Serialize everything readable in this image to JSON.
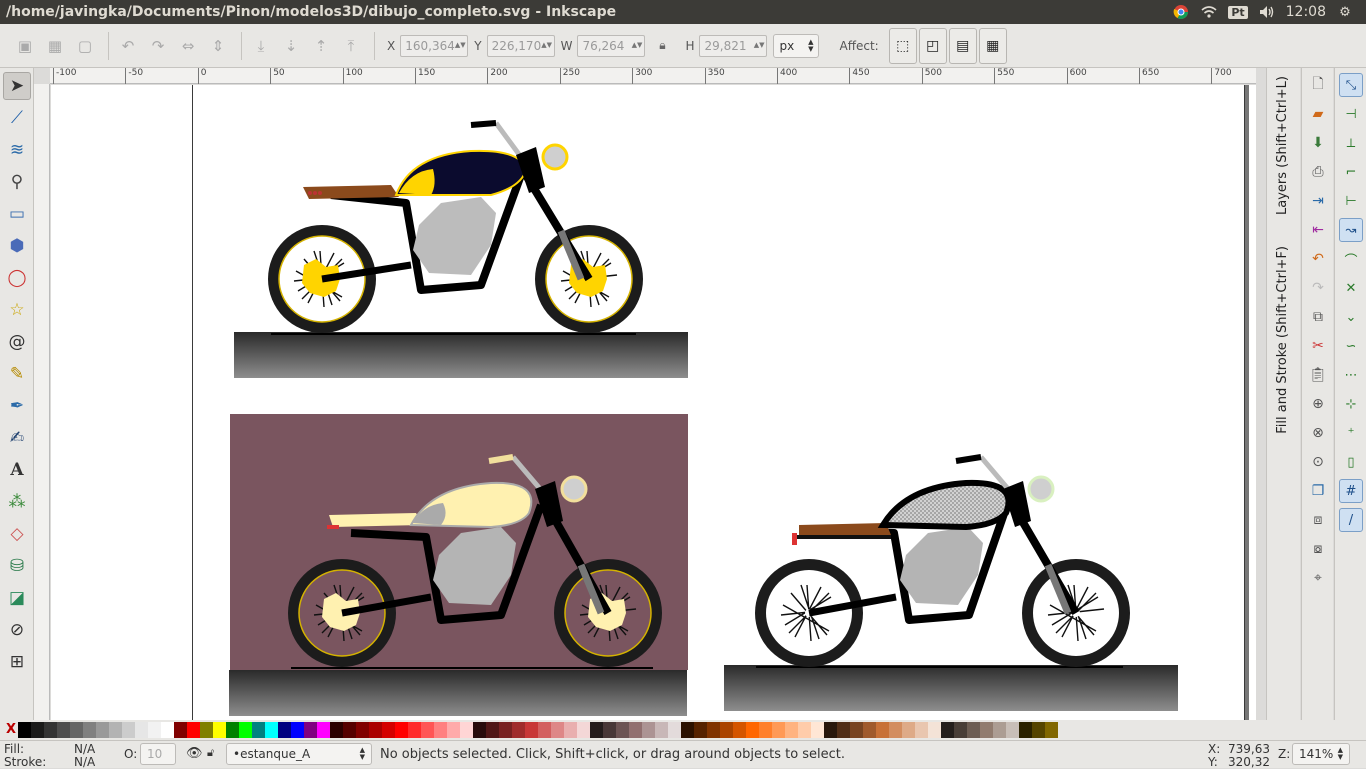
{
  "titlebar": {
    "title": "/home/javingka/Documents/Pinon/modelos3D/dibujo_completo.svg - Inkscape",
    "lang": "Pt",
    "clock": "12:08"
  },
  "controls": {
    "x_label": "X",
    "x_value": "160,364",
    "y_label": "Y",
    "y_value": "226,170",
    "w_label": "W",
    "w_value": "76,264",
    "h_label": "H",
    "h_value": "29,821",
    "unit": "px",
    "affect_label": "Affect:"
  },
  "ruler": {
    "ticks": [
      "-100",
      "-50",
      "0",
      "50",
      "100",
      "150",
      "200",
      "250",
      "300",
      "350",
      "400",
      "450",
      "500",
      "550",
      "600",
      "650",
      "700"
    ]
  },
  "docks": {
    "layers_tab": "Layers (Shift+Ctrl+L)",
    "fill_stroke_tab": "Fill and Stroke (Shift+Ctrl+F)"
  },
  "palette": {
    "none_label": "X",
    "colors": [
      "#000000",
      "#1a1a1a",
      "#333333",
      "#4d4d4d",
      "#666666",
      "#808080",
      "#999999",
      "#b3b3b3",
      "#cccccc",
      "#e6e6e6",
      "#f2f2f2",
      "#ffffff",
      "#800000",
      "#ff0000",
      "#808000",
      "#ffff00",
      "#008000",
      "#00ff00",
      "#008080",
      "#00ffff",
      "#000080",
      "#0000ff",
      "#800080",
      "#ff00ff",
      "#2b0000",
      "#550000",
      "#800000",
      "#aa0000",
      "#d40000",
      "#ff0000",
      "#ff2a2a",
      "#ff5555",
      "#ff8080",
      "#ffaaaa",
      "#ffd5d5",
      "#280b0b",
      "#501616",
      "#782121",
      "#a02c2c",
      "#c83737",
      "#d35f5f",
      "#de8787",
      "#e9afaf",
      "#f4d7d7",
      "#241c1c",
      "#483737",
      "#6c5353",
      "#916f6f",
      "#ac9393",
      "#c8b7b7",
      "#e3dbdb",
      "#2b1100",
      "#552200",
      "#803300",
      "#aa4400",
      "#d45500",
      "#ff6600",
      "#ff7f2a",
      "#ff9955",
      "#ffb380",
      "#ffccaa",
      "#ffe6d5",
      "#28170b",
      "#502d16",
      "#784421",
      "#a05a2c",
      "#c87137",
      "#d38d5f",
      "#deaa87",
      "#e9c6af",
      "#f4e3d7",
      "#241f1c",
      "#483e37",
      "#6c5d53",
      "#917c6f",
      "#ac9d93",
      "#c8beb7",
      "#2b2200",
      "#554400",
      "#806600"
    ]
  },
  "status": {
    "fill_label": "Fill:",
    "fill_value": "N/A",
    "stroke_label": "Stroke:",
    "stroke_value": "N/A",
    "opacity_label": "O:",
    "opacity_value": "10",
    "layer": "•estanque_A",
    "message": "No objects selected. Click, Shift+click, or drag around objects to select.",
    "x_label": "X:",
    "x_value": "739,63",
    "y_label": "Y:",
    "y_value": "320,32",
    "zoom_label": "Z:",
    "zoom_value": "141%"
  },
  "colors": {
    "tank_dark": "#0b0b2e",
    "tank_cream": "#fff1b0",
    "accent_yellow": "#ffd400",
    "seat_brown": "#8b4a1c",
    "panel_mauve": "#7a555f"
  }
}
